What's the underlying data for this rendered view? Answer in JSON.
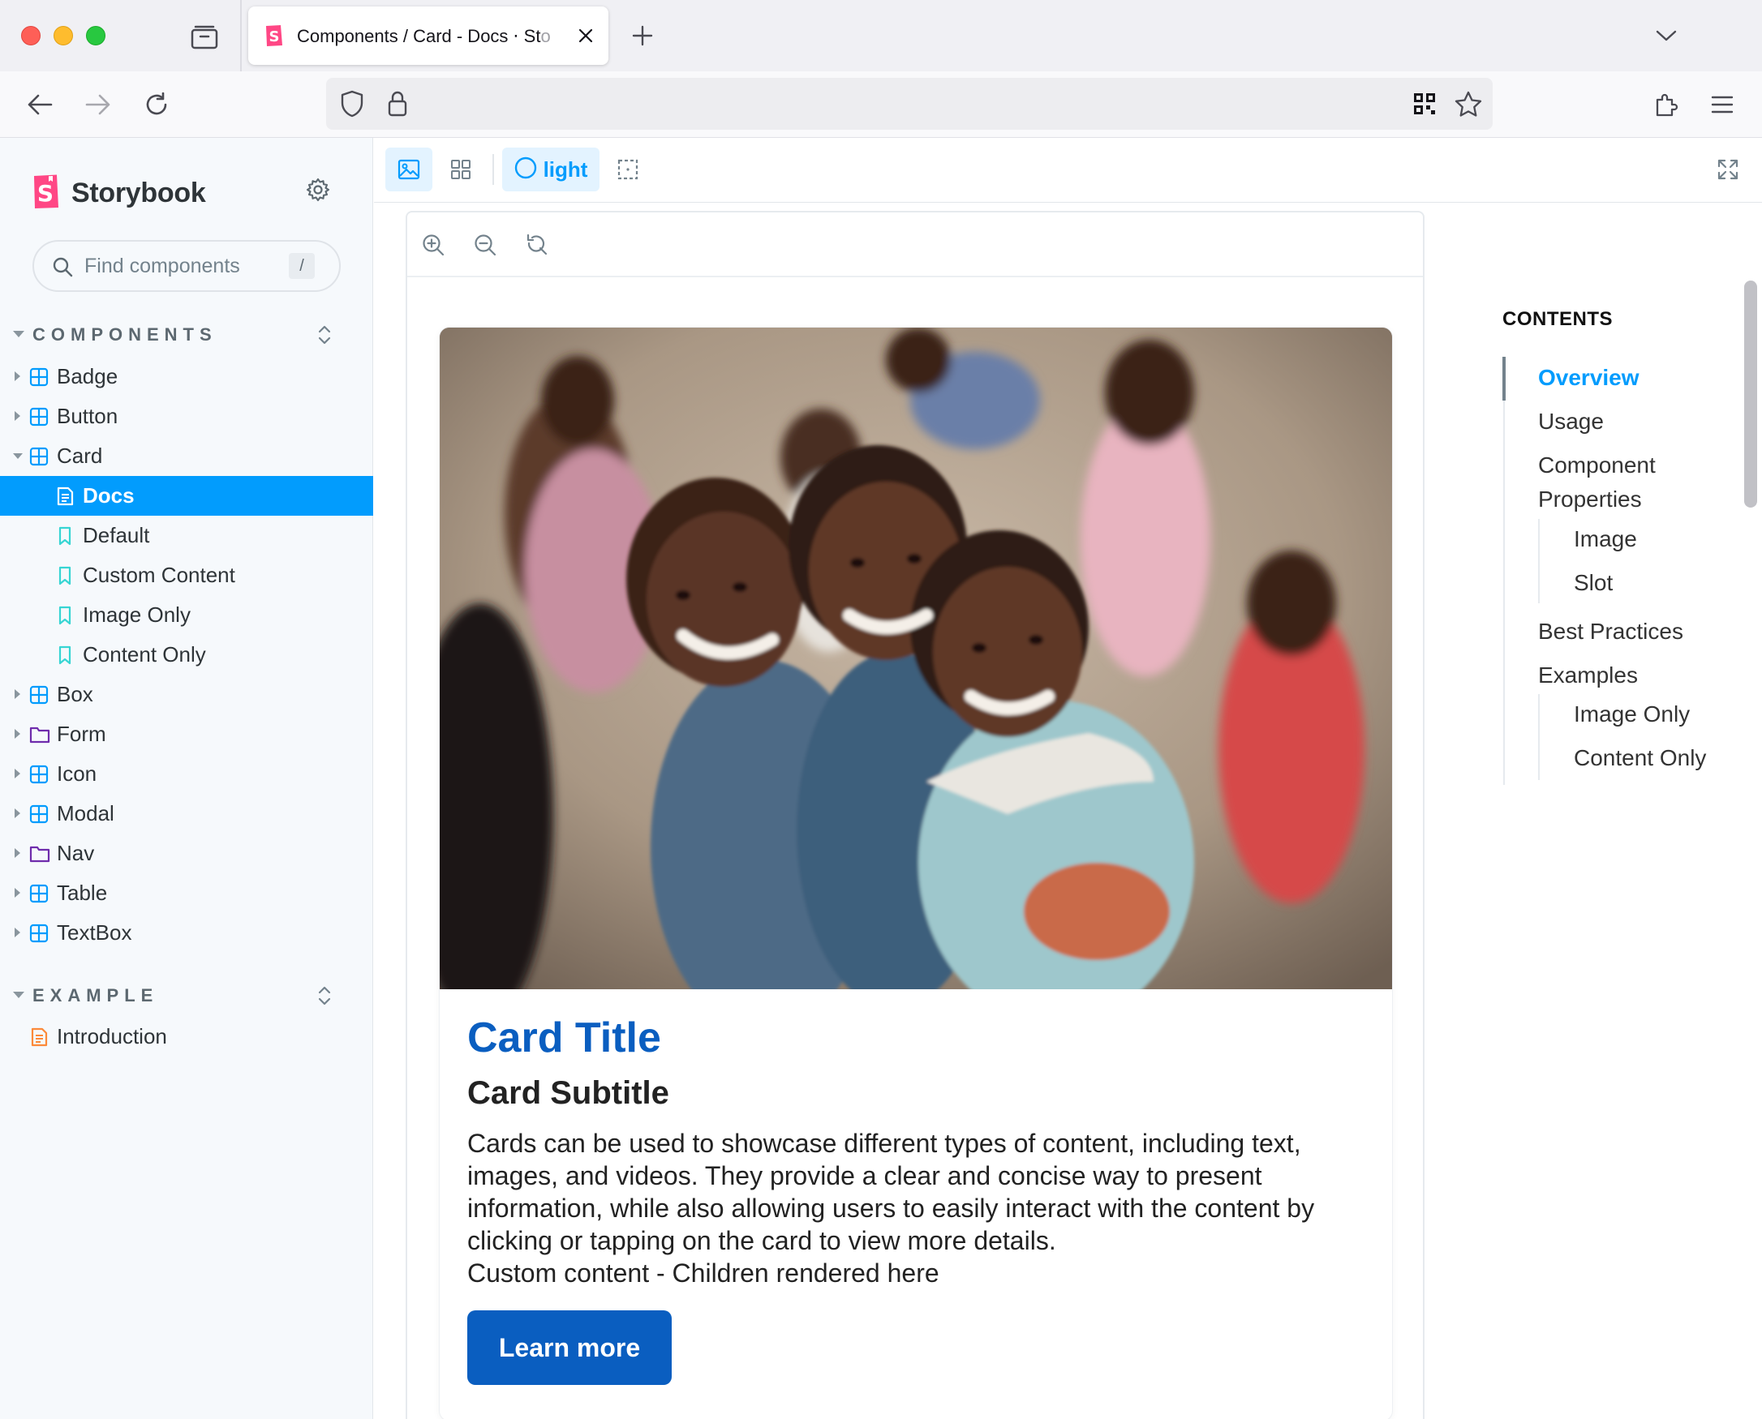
{
  "browser": {
    "tab_title": "Components / Card - Docs ⋅ St",
    "tab_title_fade": "o",
    "url_text": ""
  },
  "sidebar": {
    "brand": "Storybook",
    "search_placeholder": "Find components",
    "search_shortcut": "/",
    "sections": [
      {
        "label": "COMPONENTS",
        "items": [
          {
            "label": "Badge",
            "icon": "component-icon",
            "expanded": false
          },
          {
            "label": "Button",
            "icon": "component-icon",
            "expanded": false
          },
          {
            "label": "Card",
            "icon": "component-icon",
            "expanded": true
          },
          {
            "label": "Docs",
            "icon": "document-icon",
            "selected": true
          },
          {
            "label": "Default",
            "icon": "bookmark-icon"
          },
          {
            "label": "Custom Content",
            "icon": "bookmark-icon"
          },
          {
            "label": "Image Only",
            "icon": "bookmark-icon"
          },
          {
            "label": "Content Only",
            "icon": "bookmark-icon"
          },
          {
            "label": "Box",
            "icon": "component-icon",
            "expanded": false
          },
          {
            "label": "Form",
            "icon": "folder-icon",
            "expanded": false
          },
          {
            "label": "Icon",
            "icon": "component-icon",
            "expanded": false
          },
          {
            "label": "Modal",
            "icon": "component-icon",
            "expanded": false
          },
          {
            "label": "Nav",
            "icon": "folder-icon",
            "expanded": false
          },
          {
            "label": "Table",
            "icon": "component-icon",
            "expanded": false
          },
          {
            "label": "TextBox",
            "icon": "component-icon",
            "expanded": false
          }
        ]
      },
      {
        "label": "EXAMPLE",
        "items": [
          {
            "label": "Introduction",
            "icon": "document-icon"
          }
        ]
      }
    ]
  },
  "toolbar": {
    "theme_label": "light"
  },
  "card": {
    "image_alt": "Group of smiling children hugging outdoors",
    "title": "Card Title",
    "subtitle": "Card Subtitle",
    "body": "Cards can be used to showcase different types of content, including text, images, and videos. They provide a clear and concise way to present information, while also allowing users to easily interact with the content by clicking or tapping on the card to view more details.",
    "custom": "Custom content - Children rendered here",
    "button": "Learn more"
  },
  "toc": {
    "heading": "CONTENTS",
    "items": [
      "Overview",
      "Usage",
      "Component",
      "Properties",
      "Image",
      "Slot",
      "Best Practices",
      "Examples",
      "Image Only",
      "Content Only"
    ]
  },
  "colors": {
    "accent": "#029cfd",
    "card_primary": "#0a5ec0",
    "storybook_pink": "#ff4785"
  }
}
